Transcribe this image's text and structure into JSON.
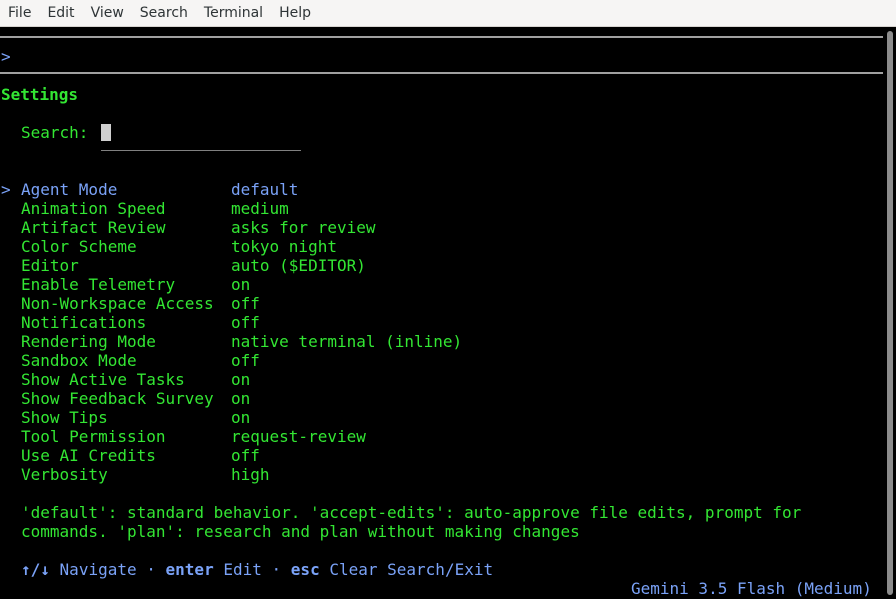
{
  "menubar": {
    "items": [
      "File",
      "Edit",
      "View",
      "Search",
      "Terminal",
      "Help"
    ]
  },
  "prompt": {
    "symbol": ">"
  },
  "settings": {
    "title": "Settings",
    "search_label": "Search:",
    "search_value": "",
    "selected_marker": ">",
    "items": [
      {
        "label": "Agent Mode",
        "value": "default"
      },
      {
        "label": "Animation Speed",
        "value": "medium"
      },
      {
        "label": "Artifact Review",
        "value": "asks for review"
      },
      {
        "label": "Color Scheme",
        "value": "tokyo night"
      },
      {
        "label": "Editor",
        "value": "auto ($EDITOR)"
      },
      {
        "label": "Enable Telemetry",
        "value": "on"
      },
      {
        "label": "Non-Workspace Access",
        "value": "off"
      },
      {
        "label": "Notifications",
        "value": "off"
      },
      {
        "label": "Rendering Mode",
        "value": "native terminal (inline)"
      },
      {
        "label": "Sandbox Mode",
        "value": "off"
      },
      {
        "label": "Show Active Tasks",
        "value": "on"
      },
      {
        "label": "Show Feedback Survey",
        "value": "on"
      },
      {
        "label": "Show Tips",
        "value": "on"
      },
      {
        "label": "Tool Permission",
        "value": "request-review"
      },
      {
        "label": "Use AI Credits",
        "value": "off"
      },
      {
        "label": "Verbosity",
        "value": "high"
      }
    ],
    "description_line1": "'default': standard behavior. 'accept-edits': auto-approve file edits, prompt for",
    "description_line2": "commands. 'plan': research and plan without making changes"
  },
  "hints": {
    "nav_key": "↑/↓",
    "nav_label": "Navigate",
    "sep1": "·",
    "enter_key": "enter",
    "enter_label": "Edit",
    "sep2": "·",
    "esc_key": "esc",
    "esc_label": "Clear Search/Exit"
  },
  "status": {
    "model": "Gemini 3.5 Flash (Medium)"
  },
  "colors": {
    "accent_green": "#33e633",
    "accent_blue": "#7aa2f7",
    "background": "#000000"
  }
}
